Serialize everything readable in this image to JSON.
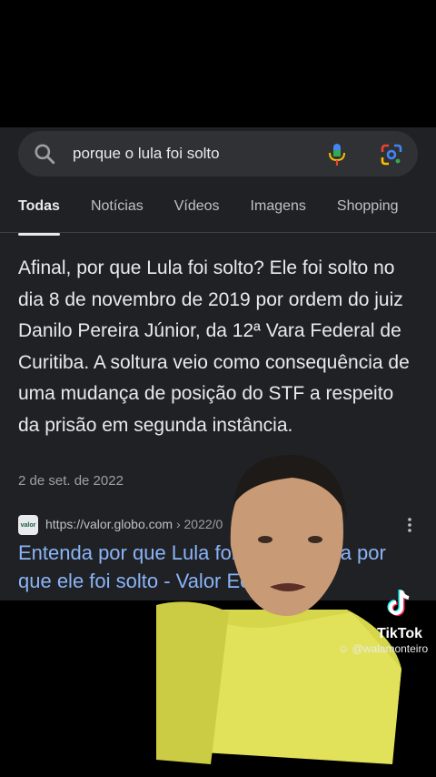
{
  "search": {
    "query": "porque o lula foi solto"
  },
  "tabs": [
    {
      "label": "Todas"
    },
    {
      "label": "Notícias"
    },
    {
      "label": "Vídeos"
    },
    {
      "label": "Imagens"
    },
    {
      "label": "Shopping"
    }
  ],
  "snippet": {
    "text": "Afinal, por que Lula foi solto? Ele foi solto no dia 8 de novembro de 2019 por ordem do juiz Danilo Pereira Júnior, da 12ª Vara Federal de Curitiba. A soltura veio como consequência de uma mudança de posição do STF a respeito da prisão em segunda instância.",
    "date": "2 de set. de 2022"
  },
  "result": {
    "favicon_text": "valor",
    "url_host": "https://valor.globo.com",
    "url_path": " › 2022/0",
    "title": "Entenda por que Lula foi solto? Saiba por que ele foi solto - Valor Econômico"
  },
  "watermark": {
    "brand": "TikTok",
    "user": "@walamonteiro"
  },
  "colors": {
    "background": "#202124",
    "link": "#8ab4f8",
    "text": "#e8eaed"
  }
}
